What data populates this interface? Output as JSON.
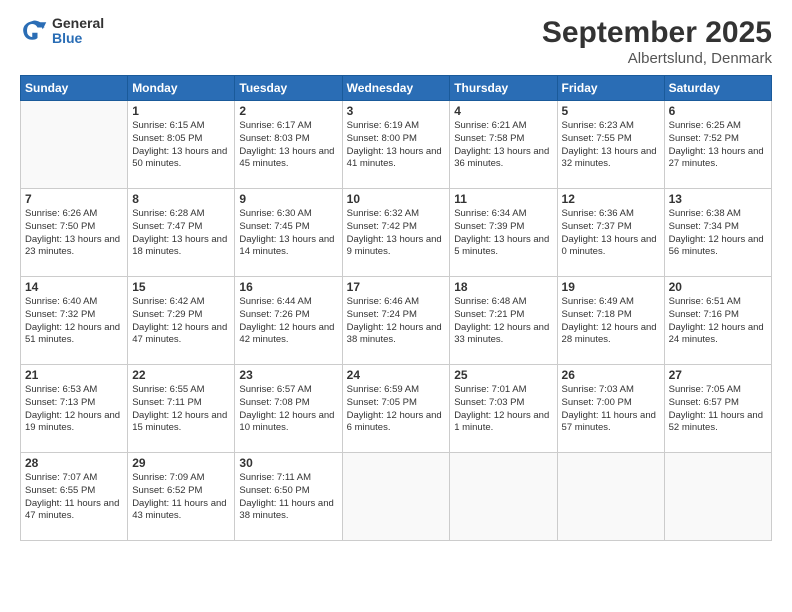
{
  "header": {
    "logo": {
      "general": "General",
      "blue": "Blue"
    },
    "title": "September 2025",
    "subtitle": "Albertslund, Denmark"
  },
  "calendar": {
    "days_of_week": [
      "Sunday",
      "Monday",
      "Tuesday",
      "Wednesday",
      "Thursday",
      "Friday",
      "Saturday"
    ],
    "weeks": [
      [
        {
          "day": "",
          "sunrise": "",
          "sunset": "",
          "daylight": ""
        },
        {
          "day": "1",
          "sunrise": "Sunrise: 6:15 AM",
          "sunset": "Sunset: 8:05 PM",
          "daylight": "Daylight: 13 hours and 50 minutes."
        },
        {
          "day": "2",
          "sunrise": "Sunrise: 6:17 AM",
          "sunset": "Sunset: 8:03 PM",
          "daylight": "Daylight: 13 hours and 45 minutes."
        },
        {
          "day": "3",
          "sunrise": "Sunrise: 6:19 AM",
          "sunset": "Sunset: 8:00 PM",
          "daylight": "Daylight: 13 hours and 41 minutes."
        },
        {
          "day": "4",
          "sunrise": "Sunrise: 6:21 AM",
          "sunset": "Sunset: 7:58 PM",
          "daylight": "Daylight: 13 hours and 36 minutes."
        },
        {
          "day": "5",
          "sunrise": "Sunrise: 6:23 AM",
          "sunset": "Sunset: 7:55 PM",
          "daylight": "Daylight: 13 hours and 32 minutes."
        },
        {
          "day": "6",
          "sunrise": "Sunrise: 6:25 AM",
          "sunset": "Sunset: 7:52 PM",
          "daylight": "Daylight: 13 hours and 27 minutes."
        }
      ],
      [
        {
          "day": "7",
          "sunrise": "Sunrise: 6:26 AM",
          "sunset": "Sunset: 7:50 PM",
          "daylight": "Daylight: 13 hours and 23 minutes."
        },
        {
          "day": "8",
          "sunrise": "Sunrise: 6:28 AM",
          "sunset": "Sunset: 7:47 PM",
          "daylight": "Daylight: 13 hours and 18 minutes."
        },
        {
          "day": "9",
          "sunrise": "Sunrise: 6:30 AM",
          "sunset": "Sunset: 7:45 PM",
          "daylight": "Daylight: 13 hours and 14 minutes."
        },
        {
          "day": "10",
          "sunrise": "Sunrise: 6:32 AM",
          "sunset": "Sunset: 7:42 PM",
          "daylight": "Daylight: 13 hours and 9 minutes."
        },
        {
          "day": "11",
          "sunrise": "Sunrise: 6:34 AM",
          "sunset": "Sunset: 7:39 PM",
          "daylight": "Daylight: 13 hours and 5 minutes."
        },
        {
          "day": "12",
          "sunrise": "Sunrise: 6:36 AM",
          "sunset": "Sunset: 7:37 PM",
          "daylight": "Daylight: 13 hours and 0 minutes."
        },
        {
          "day": "13",
          "sunrise": "Sunrise: 6:38 AM",
          "sunset": "Sunset: 7:34 PM",
          "daylight": "Daylight: 12 hours and 56 minutes."
        }
      ],
      [
        {
          "day": "14",
          "sunrise": "Sunrise: 6:40 AM",
          "sunset": "Sunset: 7:32 PM",
          "daylight": "Daylight: 12 hours and 51 minutes."
        },
        {
          "day": "15",
          "sunrise": "Sunrise: 6:42 AM",
          "sunset": "Sunset: 7:29 PM",
          "daylight": "Daylight: 12 hours and 47 minutes."
        },
        {
          "day": "16",
          "sunrise": "Sunrise: 6:44 AM",
          "sunset": "Sunset: 7:26 PM",
          "daylight": "Daylight: 12 hours and 42 minutes."
        },
        {
          "day": "17",
          "sunrise": "Sunrise: 6:46 AM",
          "sunset": "Sunset: 7:24 PM",
          "daylight": "Daylight: 12 hours and 38 minutes."
        },
        {
          "day": "18",
          "sunrise": "Sunrise: 6:48 AM",
          "sunset": "Sunset: 7:21 PM",
          "daylight": "Daylight: 12 hours and 33 minutes."
        },
        {
          "day": "19",
          "sunrise": "Sunrise: 6:49 AM",
          "sunset": "Sunset: 7:18 PM",
          "daylight": "Daylight: 12 hours and 28 minutes."
        },
        {
          "day": "20",
          "sunrise": "Sunrise: 6:51 AM",
          "sunset": "Sunset: 7:16 PM",
          "daylight": "Daylight: 12 hours and 24 minutes."
        }
      ],
      [
        {
          "day": "21",
          "sunrise": "Sunrise: 6:53 AM",
          "sunset": "Sunset: 7:13 PM",
          "daylight": "Daylight: 12 hours and 19 minutes."
        },
        {
          "day": "22",
          "sunrise": "Sunrise: 6:55 AM",
          "sunset": "Sunset: 7:11 PM",
          "daylight": "Daylight: 12 hours and 15 minutes."
        },
        {
          "day": "23",
          "sunrise": "Sunrise: 6:57 AM",
          "sunset": "Sunset: 7:08 PM",
          "daylight": "Daylight: 12 hours and 10 minutes."
        },
        {
          "day": "24",
          "sunrise": "Sunrise: 6:59 AM",
          "sunset": "Sunset: 7:05 PM",
          "daylight": "Daylight: 12 hours and 6 minutes."
        },
        {
          "day": "25",
          "sunrise": "Sunrise: 7:01 AM",
          "sunset": "Sunset: 7:03 PM",
          "daylight": "Daylight: 12 hours and 1 minute."
        },
        {
          "day": "26",
          "sunrise": "Sunrise: 7:03 AM",
          "sunset": "Sunset: 7:00 PM",
          "daylight": "Daylight: 11 hours and 57 minutes."
        },
        {
          "day": "27",
          "sunrise": "Sunrise: 7:05 AM",
          "sunset": "Sunset: 6:57 PM",
          "daylight": "Daylight: 11 hours and 52 minutes."
        }
      ],
      [
        {
          "day": "28",
          "sunrise": "Sunrise: 7:07 AM",
          "sunset": "Sunset: 6:55 PM",
          "daylight": "Daylight: 11 hours and 47 minutes."
        },
        {
          "day": "29",
          "sunrise": "Sunrise: 7:09 AM",
          "sunset": "Sunset: 6:52 PM",
          "daylight": "Daylight: 11 hours and 43 minutes."
        },
        {
          "day": "30",
          "sunrise": "Sunrise: 7:11 AM",
          "sunset": "Sunset: 6:50 PM",
          "daylight": "Daylight: 11 hours and 38 minutes."
        },
        {
          "day": "",
          "sunrise": "",
          "sunset": "",
          "daylight": ""
        },
        {
          "day": "",
          "sunrise": "",
          "sunset": "",
          "daylight": ""
        },
        {
          "day": "",
          "sunrise": "",
          "sunset": "",
          "daylight": ""
        },
        {
          "day": "",
          "sunrise": "",
          "sunset": "",
          "daylight": ""
        }
      ]
    ]
  }
}
